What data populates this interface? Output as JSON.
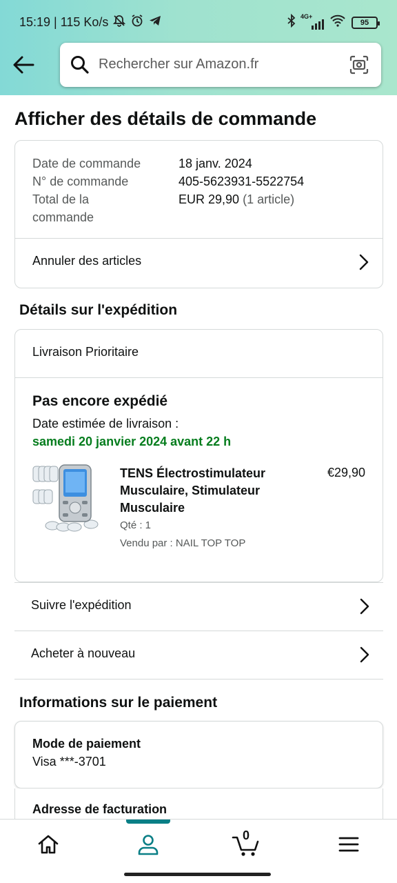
{
  "status_bar": {
    "time_speed": "15:19 | 115 Ko/s",
    "network": "4G+",
    "battery": "95"
  },
  "search": {
    "placeholder": "Rechercher sur Amazon.fr"
  },
  "page_title": "Afficher des détails de commande",
  "order": {
    "date_label": "Date de commande",
    "date_value": "18 janv. 2024",
    "number_label": "N° de commande",
    "number_value": "405-5623931-5522754",
    "total_label_line1": "Total de la",
    "total_label_line2": "commande",
    "total_value": "EUR 29,90",
    "total_count": "(1 article)",
    "cancel_label": "Annuler des articles"
  },
  "shipping": {
    "section_title": "Détails sur l'expédition",
    "type": "Livraison Prioritaire",
    "status": "Pas encore expédié",
    "estimate_label": "Date estimée de livraison :",
    "estimate_date": "samedi 20 janvier 2024 avant 22 h",
    "product": {
      "title": "TENS Électrostimulateur Musculaire, Stimulateur Musculaire",
      "price": "€29,90",
      "qty": "Qté : 1",
      "seller": "Vendu par : NAIL TOP TOP"
    },
    "track_label": "Suivre l'expédition",
    "buy_again_label": "Acheter à nouveau"
  },
  "payment": {
    "section_title": "Informations sur le paiement",
    "method_label": "Mode de paiement",
    "method_value": "Visa  ***-3701",
    "billing_label": "Adresse de facturation"
  },
  "bottom_nav": {
    "cart_count": "0",
    "active_tab": "account"
  },
  "colors": {
    "accent": "#0a7f86",
    "delivery_green": "#067d1e",
    "header_gradient_start": "#83d9d6",
    "header_gradient_end": "#a9e6cd"
  }
}
